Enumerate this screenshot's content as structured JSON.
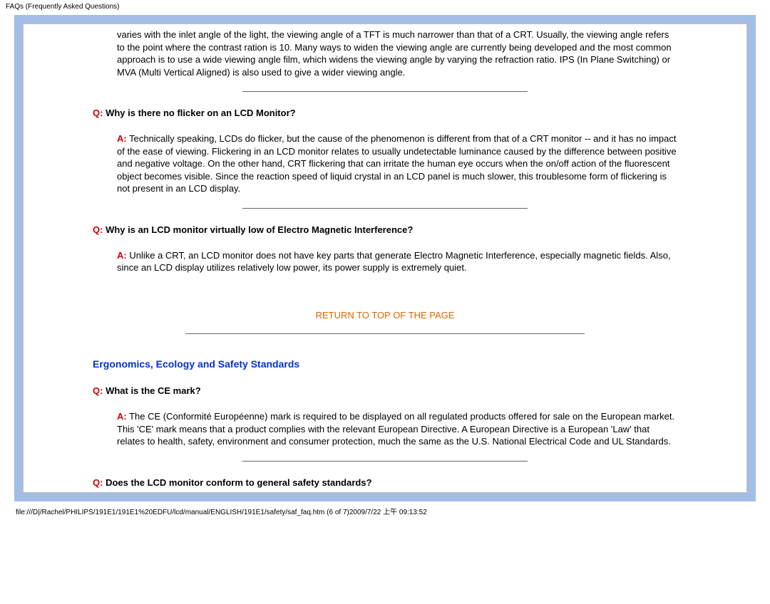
{
  "header": {
    "title": "FAQs (Frequently Asked Questions)"
  },
  "content": {
    "intro_para": "varies with the inlet angle of the light, the viewing angle of a TFT is much narrower than that of a CRT. Usually, the viewing angle refers to the point where the contrast ration is 10. Many ways to widen the viewing angle are currently being developed and the most common approach is to use a wide viewing angle film, which widens the viewing angle by varying the refraction ratio. IPS (In Plane Switching) or MVA (Multi Vertical Aligned) is also used to give a wider viewing angle.",
    "q1_label": "Q:",
    "q1_text": " Why is there no flicker on an LCD Monitor?",
    "a1_label": "A:",
    "a1_text": " Technically speaking, LCDs do flicker, but the cause of the phenomenon is different from that of a CRT monitor -- and it has no impact of the ease of viewing. Flickering in an LCD monitor relates to usually undetectable luminance caused by the difference between positive and negative voltage. On the other hand, CRT flickering that can irritate the human eye occurs when the on/off action of the fluorescent object becomes visible. Since the reaction speed of liquid crystal in an LCD panel is much slower, this troublesome form of flickering is not present in an LCD display.",
    "q2_label": "Q:",
    "q2_text": " Why is an LCD monitor virtually low of Electro Magnetic Interference?",
    "a2_label": "A:",
    "a2_text": " Unlike a CRT, an LCD monitor does not have key parts that generate Electro Magnetic Interference, especially magnetic fields. Also, since an LCD display utilizes relatively low power, its power supply is extremely quiet.",
    "return_link": "RETURN TO TOP OF THE PAGE",
    "section_heading": "Ergonomics, Ecology and Safety Standards",
    "q3_label": "Q:",
    "q3_text": " What is the CE mark?",
    "a3_label": "A:",
    "a3_text": " The CE (Conformité Européenne) mark is required to be displayed on all regulated products offered for sale on the European market. This 'CE' mark means that a product complies with the relevant European Directive. A European Directive is a European 'Law' that relates to health, safety, environment and consumer protection, much the same as the U.S. National Electrical Code and UL Standards.",
    "q4_label": "Q:",
    "q4_text": " Does the LCD monitor conform to general safety standards?"
  },
  "footer": {
    "path": "file:///D|/Rachel/PHILIPS/191E1/191E1%20EDFU/lcd/manual/ENGLISH/191E1/safety/saf_faq.htm (6 of 7)2009/7/22 上午 09:13:52"
  }
}
